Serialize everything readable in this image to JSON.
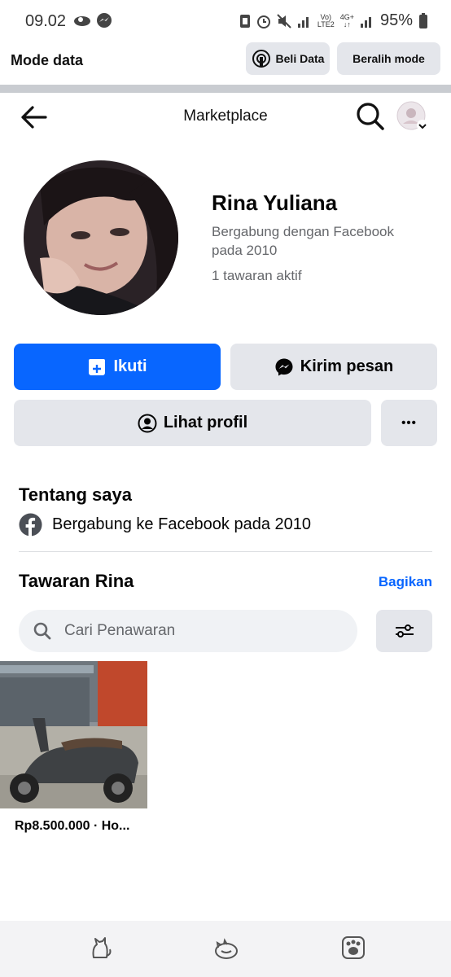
{
  "status_bar": {
    "time": "09.02",
    "battery": "95%",
    "network_small_top": "Vo)",
    "network_small_bottom": "LTE2",
    "network_gen": "4G+",
    "network_arrows": "↓↑"
  },
  "data_mode": {
    "title": "Mode data",
    "buy_label": "Beli Data",
    "switch_label": "Beralih mode"
  },
  "nav": {
    "title": "Marketplace"
  },
  "profile": {
    "name": "Rina Yuliana",
    "joined": "Bergabung dengan Facebook pada 2010",
    "active_offers": "1 tawaran aktif"
  },
  "actions": {
    "follow_label": "Ikuti",
    "message_label": "Kirim pesan",
    "view_profile_label": "Lihat profil",
    "more_label": "•••"
  },
  "about": {
    "heading": "Tentang saya",
    "joined_text": "Bergabung ke Facebook pada 2010"
  },
  "listings": {
    "heading": "Tawaran Rina",
    "share_label": "Bagikan",
    "search_placeholder": "Cari Penawaran",
    "items": [
      {
        "caption": "Rp8.500.000 · Ho..."
      }
    ]
  },
  "colors": {
    "accent": "#0866ff",
    "secondary_button": "#e4e6eb",
    "muted_text": "#65676b"
  },
  "icons": {
    "back": "arrow-left-icon",
    "search": "search-icon",
    "filter": "sliders-icon",
    "follow": "store-plus-icon",
    "message": "messenger-icon",
    "profile": "person-circle-icon",
    "facebook": "facebook-icon",
    "bottom_nav": [
      "cat-sitting-icon",
      "cat-sleeping-icon",
      "paw-icon"
    ]
  }
}
